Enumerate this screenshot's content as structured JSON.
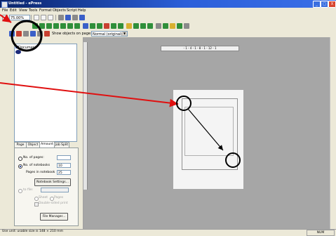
{
  "window": {
    "title": "Untitled - ePress",
    "controls": {
      "minimize": "_",
      "maximize": "□",
      "close": "X"
    }
  },
  "menu": [
    "File",
    "Edit",
    "View",
    "Tools",
    "Format",
    "Objects",
    "Script",
    "Help"
  ],
  "toolbar": {
    "zoom_value": "75.00%",
    "show_objects_label": "Show objects on page:",
    "page_select_value": "Normal (original) page only"
  },
  "tree": {
    "item_label": "Document"
  },
  "tabs": [
    "Page",
    "Object",
    "Amount",
    "Job Split"
  ],
  "amount_panel": {
    "no_pages_label": "No. of pages:",
    "no_pages_value": "",
    "no_notebooks_label": "No. of notebooks",
    "no_notebooks_value": "10",
    "pages_in_notebook_label": "Pages in notebook",
    "pages_in_notebook_value": "25",
    "notebook_settings_button": "Notebook Settings...",
    "to_file_label": "to file:",
    "sheet_label": "Sheet",
    "pages_label": "Pages",
    "double_sided_label": "Double-sided print",
    "file_manager_button": "File Manager..."
  },
  "ruler": {
    "text": "- 1 - 4 - 1 - 8 - 1 - 12 - 1"
  },
  "status": {
    "text": "Use unit: usable size is 148 × 210 mm",
    "right": "NUM"
  },
  "colors": {
    "titlebar": "#0a246a",
    "annotation": "#e01010",
    "workspace": "#a6a6a6"
  }
}
